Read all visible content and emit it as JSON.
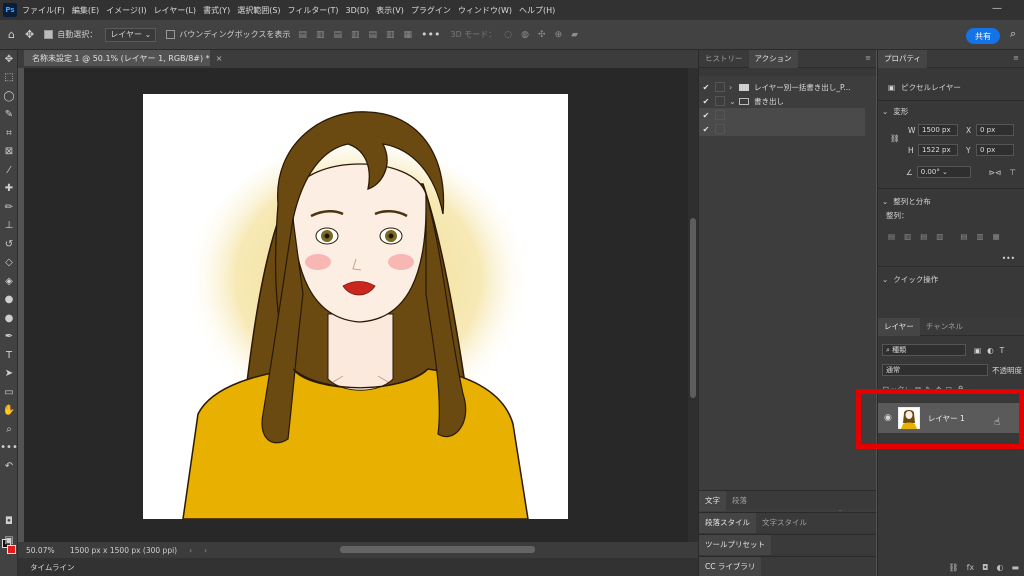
{
  "menubar": {
    "logo": "Ps",
    "items": [
      "ファイル(F)",
      "編集(E)",
      "イメージ(I)",
      "レイヤー(L)",
      "書式(Y)",
      "選択範囲(S)",
      "フィルター(T)",
      "3D(D)",
      "表示(V)",
      "プラグイン",
      "ウィンドウ(W)",
      "ヘルプ(H)"
    ]
  },
  "options": {
    "auto_select_label": "自動選択：",
    "auto_select_value": "レイヤー",
    "bounding_box_label": "バウンディングボックスを表示",
    "mode_3d": "3D モード：",
    "share": "共有"
  },
  "document": {
    "tab_title": "名称未設定 1 @ 50.1% (レイヤー 1, RGB/8#) *",
    "zoom": "50.07%",
    "size": "1500 px x 1500 px (300 ppi)"
  },
  "timeline": {
    "label": "タイムライン"
  },
  "history_actions": {
    "tabs": [
      "ヒストリー",
      "アクション"
    ],
    "rows": [
      {
        "text": "レイヤー別一括書き出し_P..."
      },
      {
        "text": "書き出し"
      },
      {
        "text": ""
      },
      {
        "text": ""
      }
    ]
  },
  "mid_subpanels": {
    "text_tabs": [
      "文字",
      "段落"
    ],
    "style_tabs": [
      "段落スタイル",
      "文字スタイル"
    ],
    "tool_preset": "ツールプリセット",
    "cc_library": "CC ライブラリ"
  },
  "properties": {
    "tab": "プロパティ",
    "kind": "ピクセルレイヤー",
    "transform_label": "変形",
    "w_label": "W",
    "w_value": "1500 px",
    "x_label": "X",
    "x_value": "0 px",
    "h_label": "H",
    "h_value": "1522 px",
    "y_label": "Y",
    "y_value": "0 px",
    "angle_value": "0.00°",
    "align_label": "整列と分布",
    "align_sub": "整列：",
    "quick_label": "クイック操作"
  },
  "layers": {
    "tabs": [
      "レイヤー",
      "チャンネル"
    ],
    "filter_kind": "種類",
    "blend_mode": "通常",
    "opacity_label": "不透明度",
    "lock_label": "ロック：",
    "layer_name": "レイヤー 1"
  },
  "colors": {
    "accent": "#1473e6",
    "highlight": "#e50000",
    "foreground": "#111111",
    "background": "#e21b1b",
    "sweater": "#e8b000",
    "hair": "#6b4a12"
  }
}
